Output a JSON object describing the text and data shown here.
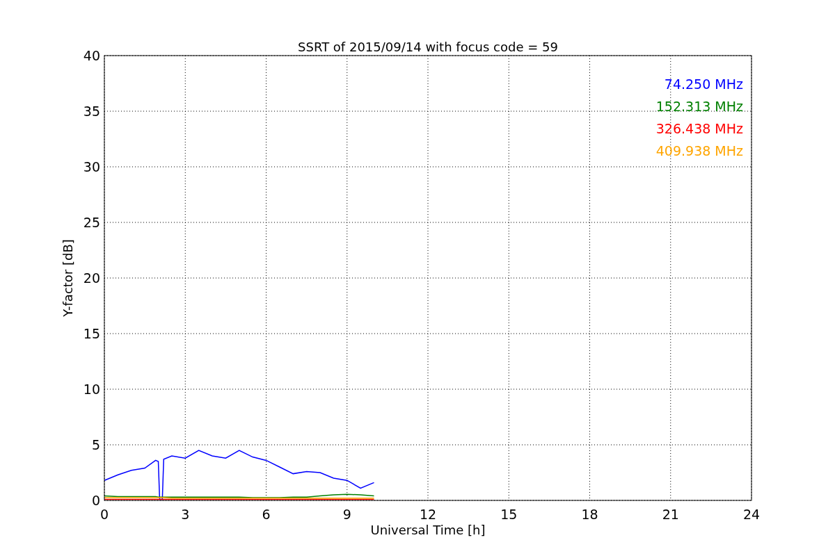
{
  "figure": {
    "chart_data": {
      "type": "line",
      "title": "SSRT of 2015/09/14 with focus code = 59",
      "xlabel": "Universal Time [h]",
      "ylabel": "Y-factor [dB]",
      "x": [
        0,
        0.5,
        1,
        1.5,
        1.9,
        2.0,
        2.05,
        2.15,
        2.2,
        2.5,
        3,
        3.5,
        4,
        4.5,
        5,
        5.5,
        6,
        6.5,
        7,
        7.5,
        8,
        8.5,
        9,
        9.5,
        10
      ],
      "series": [
        {
          "name": "74.250 MHz",
          "color": "#0000ff",
          "values": [
            1.8,
            2.3,
            2.7,
            2.9,
            3.6,
            3.5,
            0.1,
            0.1,
            3.7,
            4.0,
            3.8,
            4.5,
            4.0,
            3.8,
            4.5,
            3.9,
            3.6,
            3.0,
            2.4,
            2.6,
            2.5,
            2.0,
            1.8,
            1.1,
            1.6
          ]
        },
        {
          "name": "152.313 MHz",
          "color": "#008000",
          "values": [
            0.4,
            0.35,
            0.35,
            0.35,
            0.35,
            0.3,
            0.3,
            0.3,
            0.3,
            0.3,
            0.3,
            0.3,
            0.3,
            0.3,
            0.3,
            0.25,
            0.25,
            0.25,
            0.3,
            0.3,
            0.4,
            0.5,
            0.55,
            0.5,
            0.4
          ]
        },
        {
          "name": "326.438 MHz",
          "color": "#ff0000",
          "values": [
            0.1,
            0.1,
            0.1,
            0.1,
            0.1,
            0.1,
            0.1,
            0.1,
            0.1,
            0.1,
            0.1,
            0.1,
            0.1,
            0.1,
            0.1,
            0.1,
            0.1,
            0.1,
            0.1,
            0.1,
            0.1,
            0.1,
            0.1,
            0.1,
            0.1
          ]
        },
        {
          "name": "409.938 MHz",
          "color": "#ffa500",
          "values": [
            0.25,
            0.25,
            0.25,
            0.25,
            0.25,
            0.25,
            0.25,
            0.25,
            0.25,
            0.2,
            0.2,
            0.2,
            0.2,
            0.2,
            0.2,
            0.2,
            0.2,
            0.2,
            0.2,
            0.2,
            0.2,
            0.2,
            0.2,
            0.2,
            0.2
          ]
        }
      ],
      "grid": true,
      "xlim": [
        0,
        24
      ],
      "ylim": [
        0,
        40
      ],
      "xticks": [
        0,
        3,
        6,
        9,
        12,
        15,
        18,
        21,
        24
      ],
      "yticks": [
        0,
        5,
        10,
        15,
        20,
        25,
        30,
        35,
        40
      ]
    }
  }
}
